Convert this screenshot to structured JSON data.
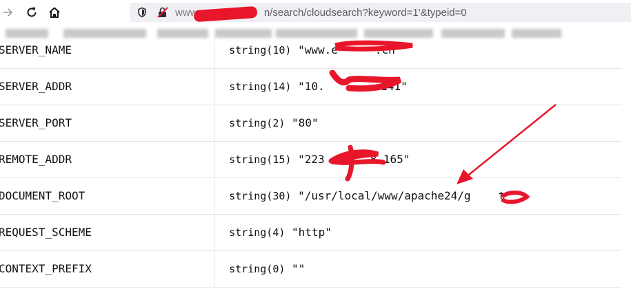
{
  "browser": {
    "back_icon": "arrow-right-icon",
    "reload_icon": "reload-icon",
    "home_icon": "home-icon",
    "url_prefix": "www.",
    "url_path": "n/search/cloudsearch?keyword=1'&typeid=0"
  },
  "rows": [
    {
      "key": "SERVER_NAME",
      "type": "string(10)",
      "value": "\"www.e",
      "tail": ".cn\""
    },
    {
      "key": "SERVER_ADDR",
      "type": "string(14)",
      "value": "\"10.",
      "tail": ".141\""
    },
    {
      "key": "SERVER_PORT",
      "type": "string(2)",
      "value": "\"80\"",
      "tail": ""
    },
    {
      "key": "REMOTE_ADDR",
      "type": "string(15)",
      "value": "\"223",
      "tail": "8.165\""
    },
    {
      "key": "DOCUMENT_ROOT",
      "type": "string(30)",
      "value": "\"/usr/local/www/apache24/g",
      "tail": "t\""
    },
    {
      "key": "REQUEST_SCHEME",
      "type": "string(4)",
      "value": "\"http\"",
      "tail": ""
    },
    {
      "key": "CONTEXT_PREFIX",
      "type": "string(0)",
      "value": "\"\"",
      "tail": ""
    }
  ],
  "colors": {
    "redaction": "#e8162a",
    "annotation_arrow": "#e8162a"
  }
}
